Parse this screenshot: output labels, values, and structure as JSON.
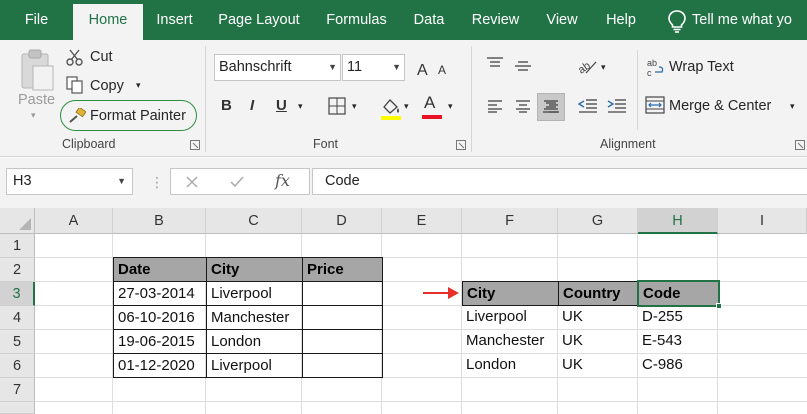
{
  "menu": {
    "tabs": [
      "File",
      "Home",
      "Insert",
      "Page Layout",
      "Formulas",
      "Data",
      "Review",
      "View",
      "Help"
    ],
    "active_tab": "Home",
    "tell_me": "Tell me what yo"
  },
  "ribbon": {
    "clipboard": {
      "paste": "Paste",
      "cut": "Cut",
      "copy": "Copy",
      "format_painter": "Format Painter",
      "label": "Clipboard"
    },
    "font": {
      "name": "Bahnschrift",
      "size": "11",
      "bold": "B",
      "italic": "I",
      "underline": "U",
      "font_color_glyph": "A",
      "label": "Font"
    },
    "alignment": {
      "wrap_text": "Wrap Text",
      "merge_center": "Merge & Center",
      "label": "Alignment"
    }
  },
  "formula_bar": {
    "name_box": "H3",
    "fx": "fx",
    "formula": "Code"
  },
  "columns": [
    "A",
    "B",
    "C",
    "D",
    "E",
    "F",
    "G",
    "H",
    "I"
  ],
  "rows": [
    "1",
    "2",
    "3",
    "4",
    "5",
    "6",
    "7"
  ],
  "table1": {
    "headers": [
      "Date",
      "City",
      "Price"
    ],
    "rows": [
      [
        "27-03-2014",
        "Liverpool",
        ""
      ],
      [
        "06-10-2016",
        "Manchester",
        ""
      ],
      [
        "19-06-2015",
        "London",
        ""
      ],
      [
        "01-12-2020",
        "Liverpool",
        ""
      ]
    ]
  },
  "table2": {
    "headers": [
      "City",
      "Country",
      "Code"
    ],
    "rows": [
      [
        "Liverpool",
        "UK",
        "D-255"
      ],
      [
        "Manchester",
        "UK",
        "E-543"
      ],
      [
        "London",
        "UK",
        "C-986"
      ]
    ]
  },
  "colors": {
    "brand": "#217346",
    "header_fill": "#a6a6a6",
    "arrow": "#e8302a",
    "font_color_bar": "#e81123",
    "highlight_bar": "#ffff00"
  }
}
